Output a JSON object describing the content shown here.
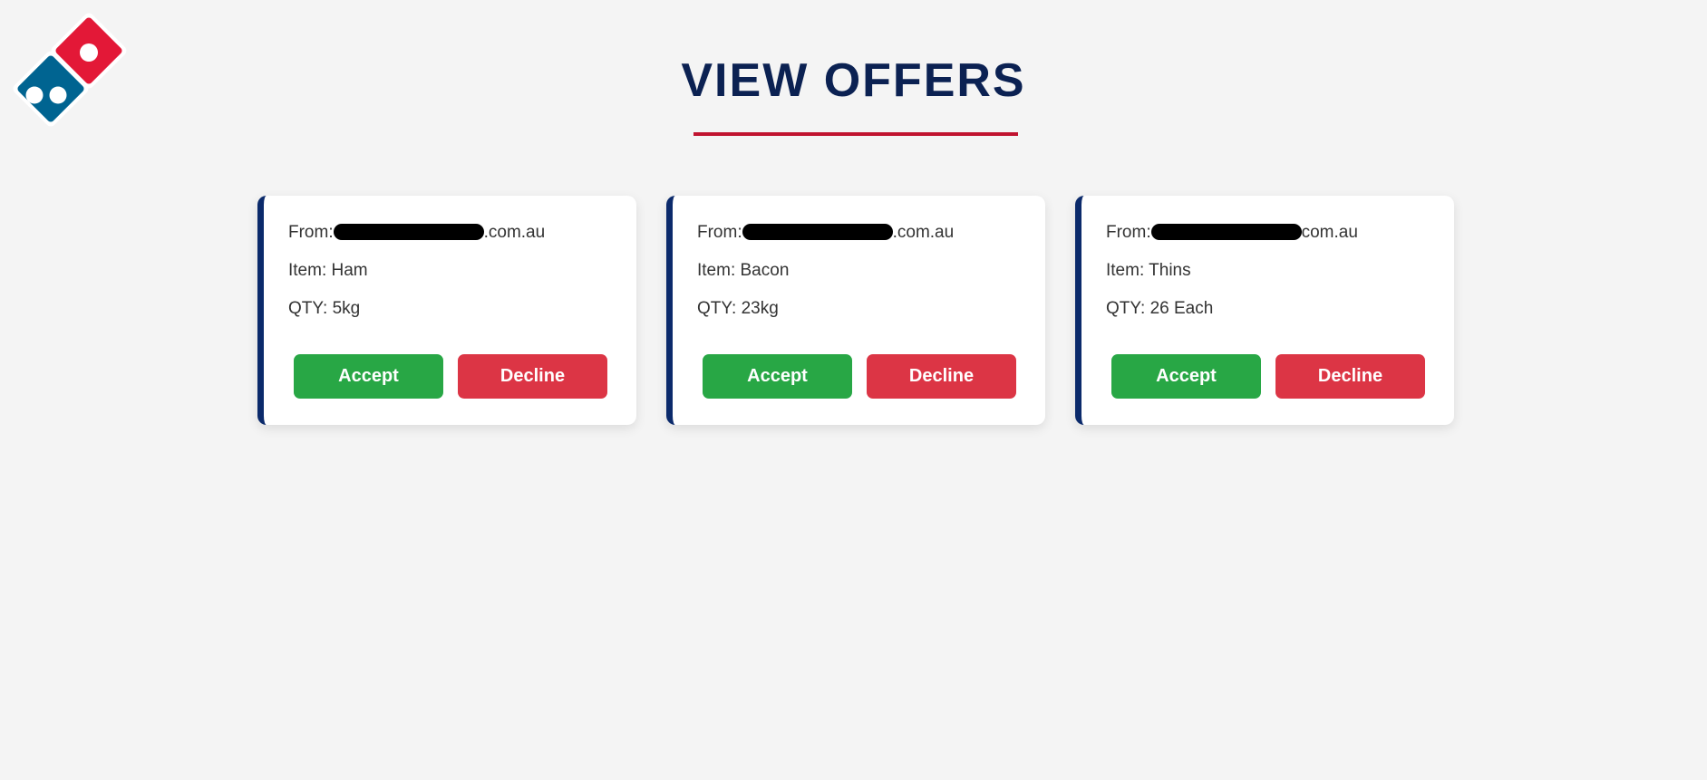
{
  "header": {
    "title": "VIEW OFFERS"
  },
  "colors": {
    "background": "#f4f4f4",
    "title": "#0b2152",
    "title_rule": "#c0132f",
    "card_accent": "#0b2a6b",
    "accept": "#28a745",
    "decline": "#dc3545",
    "logo_red": "#e31837",
    "logo_blue": "#006491"
  },
  "logo": {
    "icon": "dominos-logo"
  },
  "offers": [
    {
      "from_label": "From:",
      "from_suffix": ".com.au",
      "item": "Item: Ham",
      "qty": "QTY: 5kg",
      "accept_label": "Accept",
      "decline_label": "Decline"
    },
    {
      "from_label": "From:",
      "from_suffix": ".com.au",
      "item": "Item: Bacon",
      "qty": "QTY: 23kg",
      "accept_label": "Accept",
      "decline_label": "Decline"
    },
    {
      "from_label": "From:",
      "from_suffix": "com.au",
      "item": "Item: Thins",
      "qty": "QTY: 26 Each",
      "accept_label": "Accept",
      "decline_label": "Decline"
    }
  ]
}
